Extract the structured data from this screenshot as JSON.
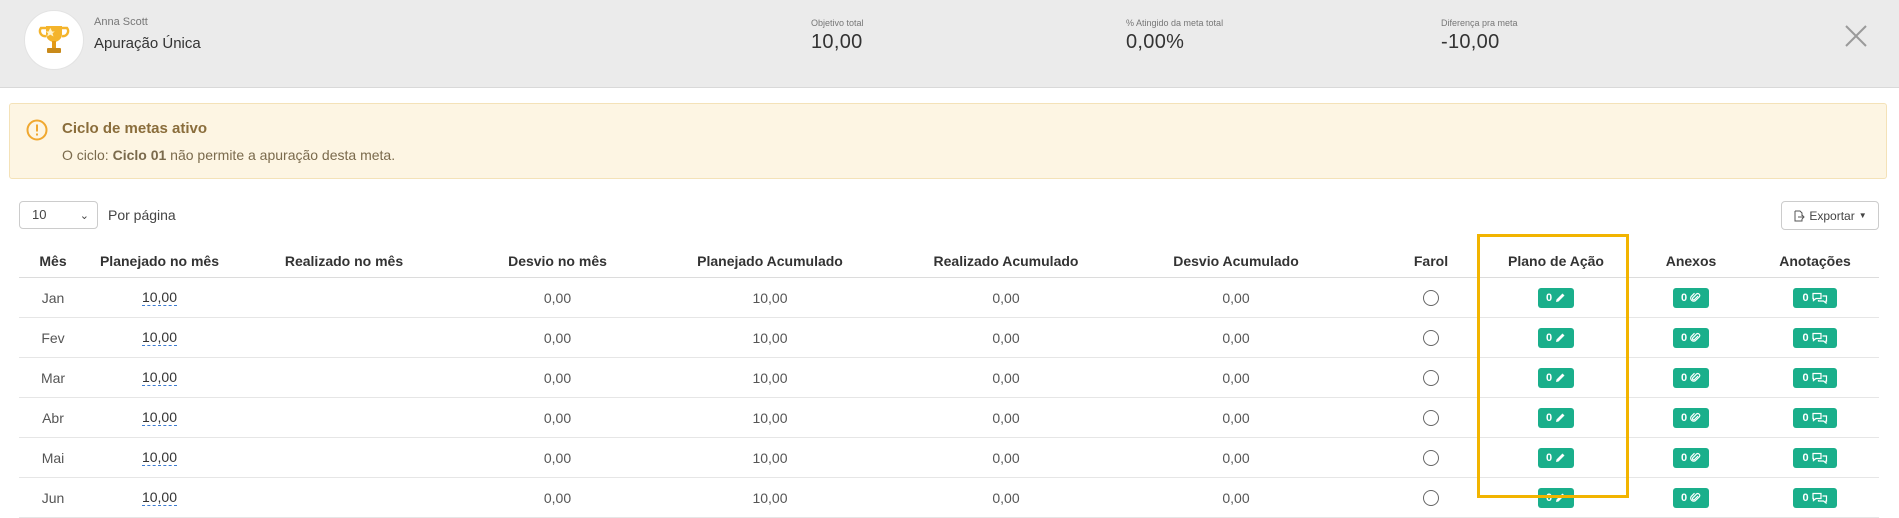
{
  "header": {
    "user_name": "Anna Scott",
    "title": "Apuração Única",
    "stats": [
      {
        "label": "Objetivo total",
        "value": "10,00"
      },
      {
        "label": "% Atingido da meta total",
        "value": "0,00%"
      },
      {
        "label": "Diferença pra meta",
        "value": "-10,00"
      }
    ]
  },
  "alert": {
    "title": "Ciclo de metas ativo",
    "msg_prefix": "O ciclo: ",
    "cycle": "Ciclo 01",
    "msg_suffix": " não permite a apuração desta meta."
  },
  "controls": {
    "per_page_value": "10",
    "per_page_label": "Por página",
    "export_label": "Exportar"
  },
  "table": {
    "columns": [
      "Mês",
      "Planejado no mês",
      "Realizado no mês",
      "Desvio no mês",
      "Planejado Acumulado",
      "Realizado Acumulado",
      "Desvio Acumulado",
      "Farol",
      "Plano de Ação",
      "Anexos",
      "Anotações"
    ],
    "rows": [
      {
        "mes": "Jan",
        "planejado": "10,00",
        "realizado": "",
        "desvio": "0,00",
        "plan_acum": "10,00",
        "real_acum": "0,00",
        "desvio_acum": "0,00",
        "plano": "0",
        "anexos": "0",
        "anotacoes": "0"
      },
      {
        "mes": "Fev",
        "planejado": "10,00",
        "realizado": "",
        "desvio": "0,00",
        "plan_acum": "10,00",
        "real_acum": "0,00",
        "desvio_acum": "0,00",
        "plano": "0",
        "anexos": "0",
        "anotacoes": "0"
      },
      {
        "mes": "Mar",
        "planejado": "10,00",
        "realizado": "",
        "desvio": "0,00",
        "plan_acum": "10,00",
        "real_acum": "0,00",
        "desvio_acum": "0,00",
        "plano": "0",
        "anexos": "0",
        "anotacoes": "0"
      },
      {
        "mes": "Abr",
        "planejado": "10,00",
        "realizado": "",
        "desvio": "0,00",
        "plan_acum": "10,00",
        "real_acum": "0,00",
        "desvio_acum": "0,00",
        "plano": "0",
        "anexos": "0",
        "anotacoes": "0"
      },
      {
        "mes": "Mai",
        "planejado": "10,00",
        "realizado": "",
        "desvio": "0,00",
        "plan_acum": "10,00",
        "real_acum": "0,00",
        "desvio_acum": "0,00",
        "plano": "0",
        "anexos": "0",
        "anotacoes": "0"
      },
      {
        "mes": "Jun",
        "planejado": "10,00",
        "realizado": "",
        "desvio": "0,00",
        "plan_acum": "10,00",
        "real_acum": "0,00",
        "desvio_acum": "0,00",
        "plano": "0",
        "anexos": "0",
        "anotacoes": "0"
      }
    ]
  },
  "colors": {
    "accent_green": "#1aaf8b",
    "highlight": "#f2b400",
    "alert_bg": "#fdf5e3",
    "alert_icon": "#f0a830"
  },
  "icons": {
    "avatar": "trophy-icon",
    "close": "close-icon",
    "alert": "warning-circle-icon",
    "export": "export-file-icon",
    "plano": "pencil-icon",
    "anexos": "paperclip-icon",
    "anotacoes": "comments-icon",
    "farol": "empty-circle-icon"
  }
}
